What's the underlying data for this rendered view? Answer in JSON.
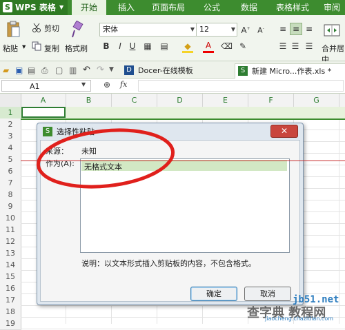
{
  "app": {
    "name": "WPS 表格",
    "logo_letter": "S"
  },
  "menu": {
    "tabs": [
      "开始",
      "插入",
      "页面布局",
      "公式",
      "数据",
      "表格样式",
      "审阅"
    ],
    "active_index": 0
  },
  "ribbon": {
    "cut": "剪切",
    "paste": "粘贴",
    "copy": "复制",
    "format_painter": "格式刷",
    "font_name": "宋体",
    "font_size": "12",
    "merge": "合并居中",
    "bold": "B",
    "italic": "I",
    "underline": "U"
  },
  "doc_tabs": {
    "docer": "Docer-在线模板",
    "workbook": "新建 Micro...作表.xls *"
  },
  "formula_bar": {
    "cell_ref": "A1",
    "fx": "fx"
  },
  "sheet": {
    "columns": [
      "A",
      "B",
      "C",
      "D",
      "E",
      "F",
      "G"
    ],
    "rows": [
      "1",
      "2",
      "3",
      "4",
      "5",
      "6",
      "7",
      "8",
      "9",
      "10",
      "11",
      "12",
      "13",
      "14",
      "15",
      "16",
      "17",
      "18",
      "19"
    ]
  },
  "dialog": {
    "title": "选择性粘贴",
    "source_label": "来源：",
    "source_value": "未知",
    "as_label": "作为(A):",
    "options": [
      "无格式文本"
    ],
    "description": "说明：以文本形式插入剪贴板的内容，不包含格式。",
    "ok_label": "确定",
    "cancel_label": "取消"
  },
  "watermark": {
    "domain": "jb51.net",
    "site": "查字典 教程网",
    "url": "jiaocheng.chazidian.com"
  },
  "colors": {
    "brand_green": "#3d8c2f",
    "annotation_red": "#e0201c",
    "selection_green": "#d2e8c4"
  }
}
